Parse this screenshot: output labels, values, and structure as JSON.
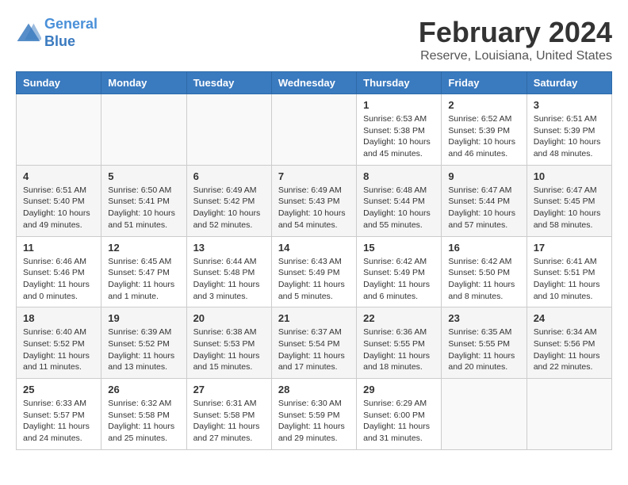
{
  "app": {
    "logo_line1": "General",
    "logo_line2": "Blue"
  },
  "title": "February 2024",
  "subtitle": "Reserve, Louisiana, United States",
  "days_of_week": [
    "Sunday",
    "Monday",
    "Tuesday",
    "Wednesday",
    "Thursday",
    "Friday",
    "Saturday"
  ],
  "weeks": [
    [
      {
        "day": "",
        "info": ""
      },
      {
        "day": "",
        "info": ""
      },
      {
        "day": "",
        "info": ""
      },
      {
        "day": "",
        "info": ""
      },
      {
        "day": "1",
        "info": "Sunrise: 6:53 AM\nSunset: 5:38 PM\nDaylight: 10 hours\nand 45 minutes."
      },
      {
        "day": "2",
        "info": "Sunrise: 6:52 AM\nSunset: 5:39 PM\nDaylight: 10 hours\nand 46 minutes."
      },
      {
        "day": "3",
        "info": "Sunrise: 6:51 AM\nSunset: 5:39 PM\nDaylight: 10 hours\nand 48 minutes."
      }
    ],
    [
      {
        "day": "4",
        "info": "Sunrise: 6:51 AM\nSunset: 5:40 PM\nDaylight: 10 hours\nand 49 minutes."
      },
      {
        "day": "5",
        "info": "Sunrise: 6:50 AM\nSunset: 5:41 PM\nDaylight: 10 hours\nand 51 minutes."
      },
      {
        "day": "6",
        "info": "Sunrise: 6:49 AM\nSunset: 5:42 PM\nDaylight: 10 hours\nand 52 minutes."
      },
      {
        "day": "7",
        "info": "Sunrise: 6:49 AM\nSunset: 5:43 PM\nDaylight: 10 hours\nand 54 minutes."
      },
      {
        "day": "8",
        "info": "Sunrise: 6:48 AM\nSunset: 5:44 PM\nDaylight: 10 hours\nand 55 minutes."
      },
      {
        "day": "9",
        "info": "Sunrise: 6:47 AM\nSunset: 5:44 PM\nDaylight: 10 hours\nand 57 minutes."
      },
      {
        "day": "10",
        "info": "Sunrise: 6:47 AM\nSunset: 5:45 PM\nDaylight: 10 hours\nand 58 minutes."
      }
    ],
    [
      {
        "day": "11",
        "info": "Sunrise: 6:46 AM\nSunset: 5:46 PM\nDaylight: 11 hours\nand 0 minutes."
      },
      {
        "day": "12",
        "info": "Sunrise: 6:45 AM\nSunset: 5:47 PM\nDaylight: 11 hours\nand 1 minute."
      },
      {
        "day": "13",
        "info": "Sunrise: 6:44 AM\nSunset: 5:48 PM\nDaylight: 11 hours\nand 3 minutes."
      },
      {
        "day": "14",
        "info": "Sunrise: 6:43 AM\nSunset: 5:49 PM\nDaylight: 11 hours\nand 5 minutes."
      },
      {
        "day": "15",
        "info": "Sunrise: 6:42 AM\nSunset: 5:49 PM\nDaylight: 11 hours\nand 6 minutes."
      },
      {
        "day": "16",
        "info": "Sunrise: 6:42 AM\nSunset: 5:50 PM\nDaylight: 11 hours\nand 8 minutes."
      },
      {
        "day": "17",
        "info": "Sunrise: 6:41 AM\nSunset: 5:51 PM\nDaylight: 11 hours\nand 10 minutes."
      }
    ],
    [
      {
        "day": "18",
        "info": "Sunrise: 6:40 AM\nSunset: 5:52 PM\nDaylight: 11 hours\nand 11 minutes."
      },
      {
        "day": "19",
        "info": "Sunrise: 6:39 AM\nSunset: 5:52 PM\nDaylight: 11 hours\nand 13 minutes."
      },
      {
        "day": "20",
        "info": "Sunrise: 6:38 AM\nSunset: 5:53 PM\nDaylight: 11 hours\nand 15 minutes."
      },
      {
        "day": "21",
        "info": "Sunrise: 6:37 AM\nSunset: 5:54 PM\nDaylight: 11 hours\nand 17 minutes."
      },
      {
        "day": "22",
        "info": "Sunrise: 6:36 AM\nSunset: 5:55 PM\nDaylight: 11 hours\nand 18 minutes."
      },
      {
        "day": "23",
        "info": "Sunrise: 6:35 AM\nSunset: 5:55 PM\nDaylight: 11 hours\nand 20 minutes."
      },
      {
        "day": "24",
        "info": "Sunrise: 6:34 AM\nSunset: 5:56 PM\nDaylight: 11 hours\nand 22 minutes."
      }
    ],
    [
      {
        "day": "25",
        "info": "Sunrise: 6:33 AM\nSunset: 5:57 PM\nDaylight: 11 hours\nand 24 minutes."
      },
      {
        "day": "26",
        "info": "Sunrise: 6:32 AM\nSunset: 5:58 PM\nDaylight: 11 hours\nand 25 minutes."
      },
      {
        "day": "27",
        "info": "Sunrise: 6:31 AM\nSunset: 5:58 PM\nDaylight: 11 hours\nand 27 minutes."
      },
      {
        "day": "28",
        "info": "Sunrise: 6:30 AM\nSunset: 5:59 PM\nDaylight: 11 hours\nand 29 minutes."
      },
      {
        "day": "29",
        "info": "Sunrise: 6:29 AM\nSunset: 6:00 PM\nDaylight: 11 hours\nand 31 minutes."
      },
      {
        "day": "",
        "info": ""
      },
      {
        "day": "",
        "info": ""
      }
    ]
  ]
}
